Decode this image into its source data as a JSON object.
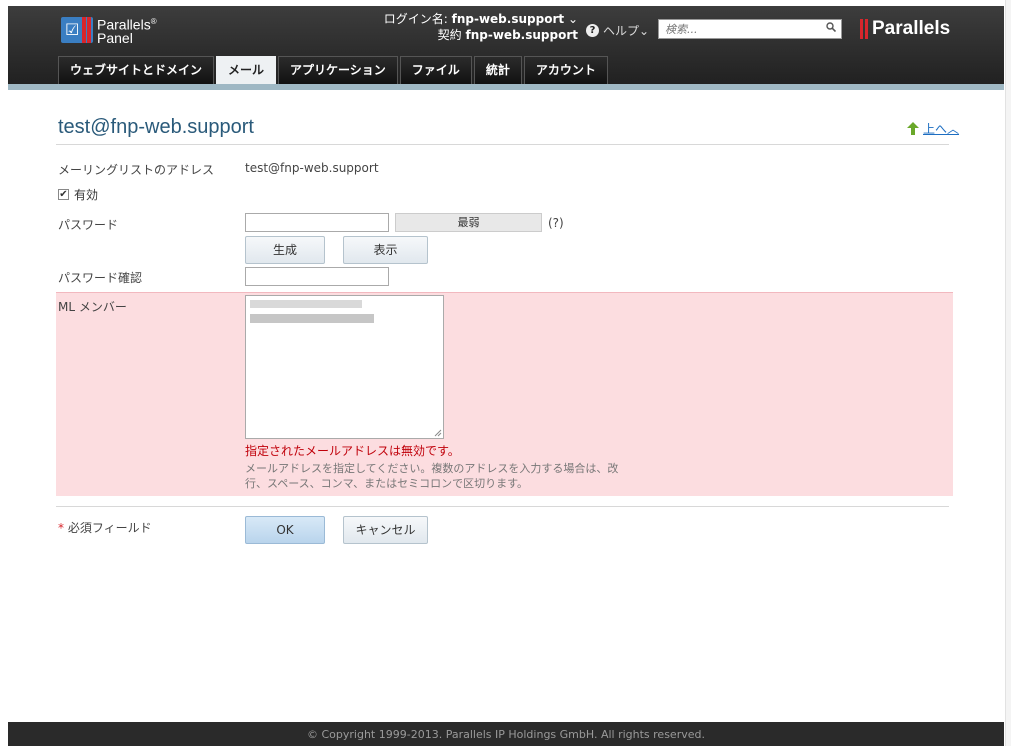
{
  "header": {
    "logo_line1": "Parallels",
    "logo_line2": "Panel",
    "login_label": "ログイン名:",
    "login_user": "fnp-web.support",
    "subscription_label": "契約",
    "subscription_value": "fnp-web.support",
    "help_label": "ヘルプ",
    "search_placeholder": "検索...",
    "brand": "Parallels"
  },
  "tabs": [
    {
      "label": "ウェブサイトとドメイン",
      "active": false
    },
    {
      "label": "メール",
      "active": true
    },
    {
      "label": "アプリケーション",
      "active": false
    },
    {
      "label": "ファイル",
      "active": false
    },
    {
      "label": "統計",
      "active": false
    },
    {
      "label": "アカウント",
      "active": false
    }
  ],
  "page": {
    "title": "test@fnp-web.support",
    "up_label": "上へ"
  },
  "form": {
    "address_label": "メーリングリストのアドレス",
    "address_value": "test@fnp-web.support",
    "enabled_label": "有効",
    "enabled_checked": true,
    "password_label": "パスワード",
    "password_value": "",
    "strength_label": "最弱",
    "help_mark": "(?)",
    "generate_label": "生成",
    "show_label": "表示",
    "confirm_label": "パスワード確認",
    "confirm_value": "",
    "members_label": "ML メンバー",
    "error_message": "指定されたメールアドレスは無効です。",
    "hint": "メールアドレスを指定してください。複数のアドレスを入力する場合は、改行、スペース、コンマ、またはセミコロンで区切ります。",
    "required_star": "*",
    "required_label": "必須フィールド",
    "ok_label": "OK",
    "cancel_label": "キャンセル"
  },
  "footer": {
    "text": "© Copyright 1999-2013. Parallels IP Holdings GmbH. All rights reserved."
  },
  "colors": {
    "error_bg": "#fcdde0",
    "error_text": "#c0000a",
    "title": "#2a5a7a",
    "brand_red": "#d8262c"
  }
}
